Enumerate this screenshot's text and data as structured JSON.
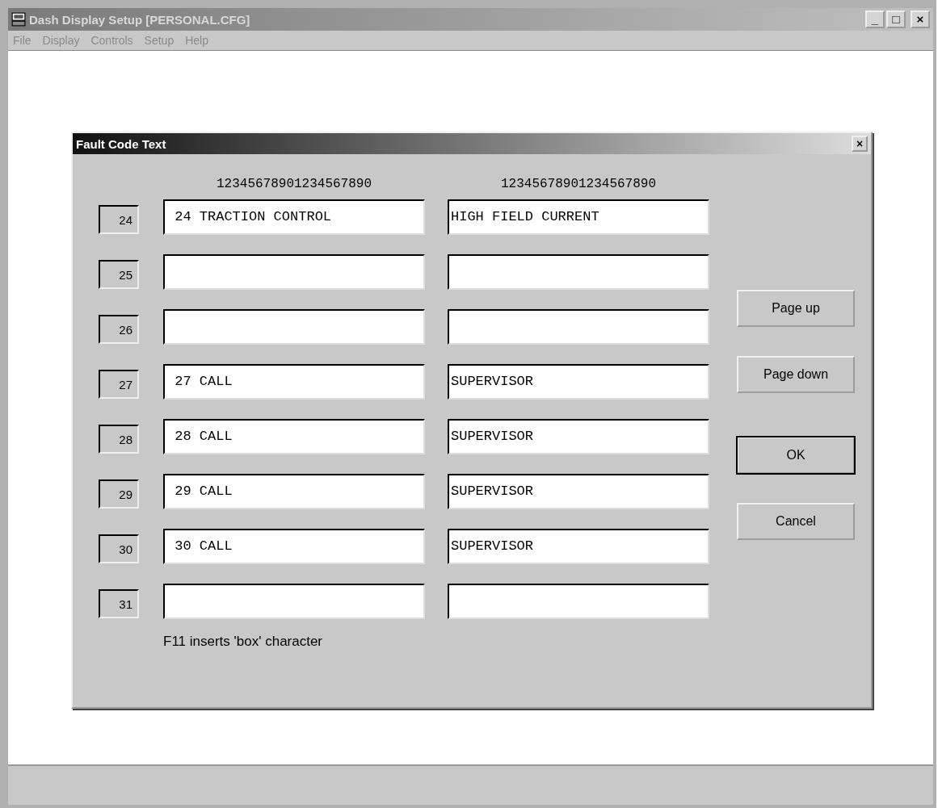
{
  "window": {
    "title": "Dash Display Setup [PERSONAL.CFG]",
    "buttons": [
      "_",
      "□",
      "×"
    ]
  },
  "menu": [
    "File",
    "Display",
    "Controls",
    "Setup",
    "Help"
  ],
  "dialog": {
    "title": "Fault Code Text",
    "close": "×",
    "column_headers": [
      "12345678901234567890",
      "12345678901234567890"
    ],
    "rows": [
      {
        "code": "24",
        "line_1": " 24 TRACTION CONTROL",
        "line_2": "HIGH FIELD CURRENT"
      },
      {
        "code": "25"
      },
      {
        "code": "26"
      },
      {
        "code": "27",
        "line_1": " 27 CALL",
        "line_2": "SUPERVISOR"
      },
      {
        "code": "28",
        "line_1": " 28 CALL",
        "line_2": "SUPERVISOR"
      },
      {
        "code": "29",
        "line_1": " 29 CALL",
        "line_2": "SUPERVISOR"
      },
      {
        "code": "30",
        "line_1": " 30 CALL",
        "line_2": "SUPERVISOR"
      },
      {
        "code": "31"
      }
    ],
    "buttons": [
      {
        "label": "Page up",
        "default": false
      },
      {
        "label": "Page down",
        "default": false
      },
      {
        "label": "OK",
        "default": true
      },
      {
        "label": "Cancel",
        "default": false
      }
    ],
    "hint": "F11 inserts 'box' character"
  }
}
